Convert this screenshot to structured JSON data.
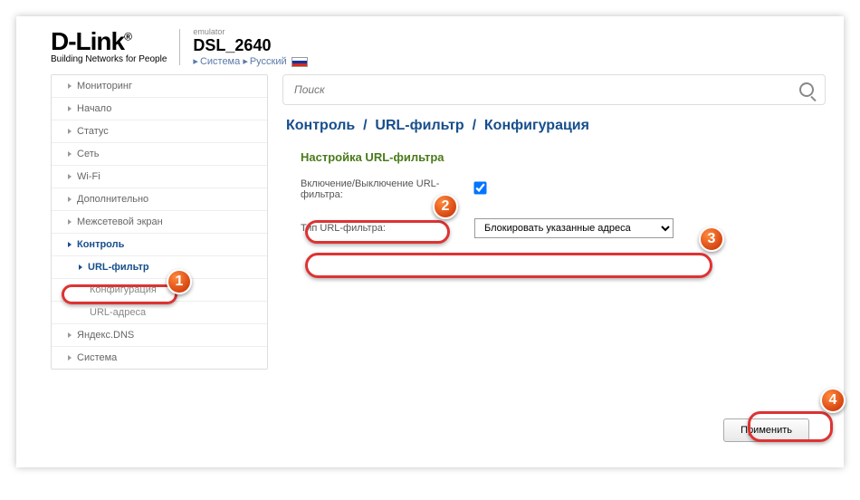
{
  "logo": {
    "main": "D-Link",
    "reg": "®",
    "sub": "Building Networks for People"
  },
  "model": {
    "small": "emulator",
    "name": "DSL_2640",
    "link1": "Система",
    "link2": "Русский"
  },
  "sidebar": {
    "items": [
      "Мониторинг",
      "Начало",
      "Статус",
      "Сеть",
      "Wi-Fi",
      "Дополнительно",
      "Межсетевой экран",
      "Контроль",
      "URL-фильтр",
      "Конфигурация",
      "URL-адреса",
      "Яндекс.DNS",
      "Система"
    ]
  },
  "search": {
    "placeholder": "Поиск"
  },
  "breadcrumb": {
    "a": "Контроль",
    "b": "URL-фильтр",
    "c": "Конфигурация"
  },
  "section": {
    "title": "Настройка URL-фильтра"
  },
  "form": {
    "enable_label": "Включение/Выключение URL-фильтра:",
    "type_label": "Тип URL-фильтра:",
    "type_value": "Блокировать указанные адреса"
  },
  "buttons": {
    "apply": "Применить"
  },
  "badges": {
    "b1": "1",
    "b2": "2",
    "b3": "3",
    "b4": "4"
  }
}
